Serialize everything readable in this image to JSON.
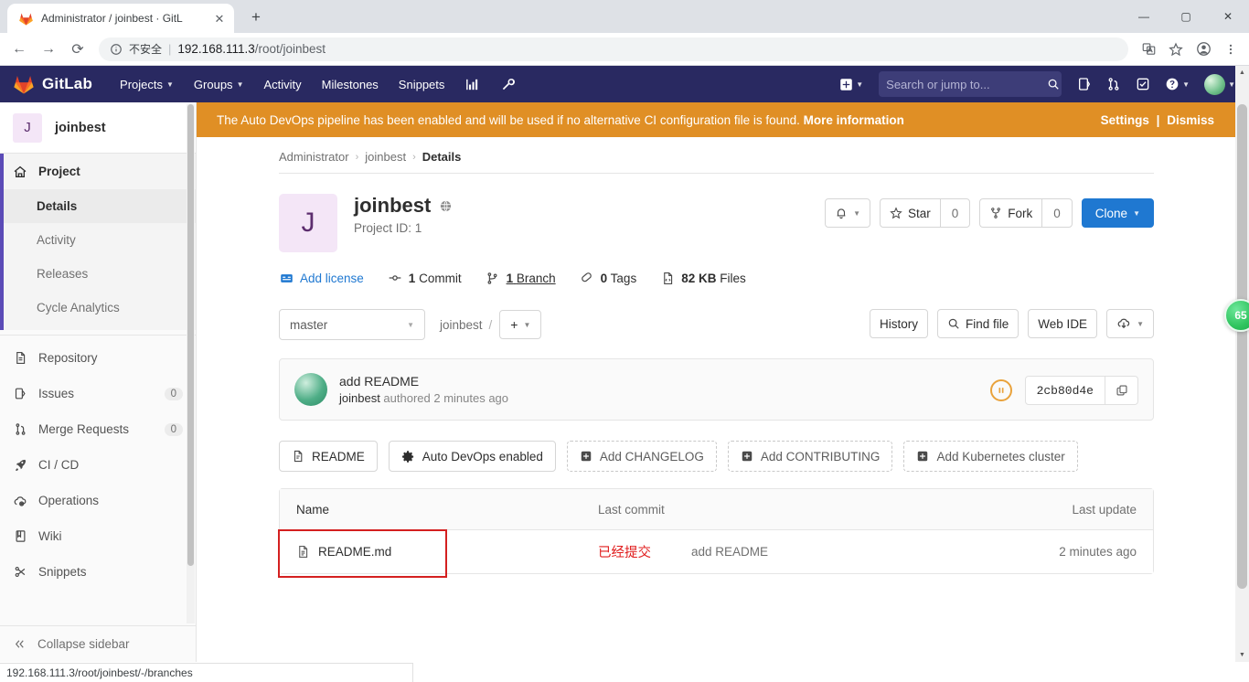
{
  "browser": {
    "tab": {
      "title": "Administrator / joinbest · GitL",
      "favicon_icon": "gitlab-tanuki-icon",
      "close_icon": "close-icon"
    },
    "new_tab_label": "+",
    "window_controls": {
      "minimize": "—",
      "maximize": "▢",
      "close": "✕"
    },
    "nav": {
      "back": "←",
      "forward": "→",
      "reload": "⟳"
    },
    "omnibox": {
      "info_icon": "info-circle-icon",
      "security_label": "不安全",
      "separator": "|",
      "url_host": "192.168.111.3",
      "url_path": "/root/joinbest"
    },
    "toolbar_icons": [
      "translate-icon",
      "bookmark-star-icon",
      "profile-icon",
      "more-menu-icon"
    ],
    "status_link": "192.168.111.3/root/joinbest/-/branches"
  },
  "navbar": {
    "brand": "GitLab",
    "links": [
      {
        "label": "Projects",
        "has_caret": true
      },
      {
        "label": "Groups",
        "has_caret": true
      },
      {
        "label": "Activity",
        "has_caret": false
      },
      {
        "label": "Milestones",
        "has_caret": false
      },
      {
        "label": "Snippets",
        "has_caret": false
      }
    ],
    "icon_links": [
      "analytics-chart-icon",
      "wrench-admin-icon"
    ],
    "plus_label": "+",
    "search_placeholder": "Search or jump to...",
    "right_icons": [
      "issues-icon",
      "merge-requests-icon",
      "todos-icon",
      "help-icon"
    ],
    "avatar_caret": "⌄"
  },
  "alert": {
    "message_plain": "The Auto DevOps pipeline has been enabled and will be used if no alternative CI configuration file is found. ",
    "message_link": "More information",
    "settings": "Settings",
    "divider": "|",
    "dismiss": "Dismiss",
    "background": "#e08f25"
  },
  "sidebar": {
    "project_initial": "J",
    "project_name": "joinbest",
    "groups": [
      {
        "label": "Project",
        "icon": "home-icon",
        "active": true,
        "children": [
          {
            "label": "Details",
            "selected": true
          },
          {
            "label": "Activity",
            "selected": false
          },
          {
            "label": "Releases",
            "selected": false
          },
          {
            "label": "Cycle Analytics",
            "selected": false
          }
        ]
      }
    ],
    "items": [
      {
        "label": "Repository",
        "icon": "document-icon",
        "count": null
      },
      {
        "label": "Issues",
        "icon": "issues-icon",
        "count": "0"
      },
      {
        "label": "Merge Requests",
        "icon": "merge-requests-icon",
        "count": "0"
      },
      {
        "label": "CI / CD",
        "icon": "rocket-icon",
        "count": null
      },
      {
        "label": "Operations",
        "icon": "cloud-gear-icon",
        "count": null
      },
      {
        "label": "Wiki",
        "icon": "book-icon",
        "count": null
      },
      {
        "label": "Snippets",
        "icon": "scissors-icon",
        "count": null
      }
    ],
    "collapse_label": "Collapse sidebar",
    "collapse_icon": "chevrons-left-icon"
  },
  "breadcrumb": {
    "items": [
      "Administrator",
      "joinbest",
      "Details"
    ],
    "separator": "›"
  },
  "project": {
    "avatar_initial": "J",
    "name": "joinbest",
    "visibility_icon": "globe-public-icon",
    "project_id_label": "Project ID: 1",
    "notification_icon": "bell-icon",
    "star_label": "Star",
    "star_count": "0",
    "fork_label": "Fork",
    "fork_count": "0",
    "clone_label": "Clone",
    "clone_accent": "#1f78d1"
  },
  "stats": [
    {
      "icon": "scale-balance-icon",
      "text": "Add license",
      "link": true,
      "bold": ""
    },
    {
      "icon": "commit-icon",
      "bold": "1",
      "text": "Commit"
    },
    {
      "icon": "branch-icon",
      "bold": "1",
      "text": "Branch",
      "underline": true
    },
    {
      "icon": "tag-icon",
      "bold": "0",
      "text": "Tags"
    },
    {
      "icon": "files-icon",
      "bold": "82 KB",
      "text": "Files"
    }
  ],
  "repo_toolbar": {
    "branch": "master",
    "path_root": "joinbest",
    "path_slash": "/",
    "add_label": "+",
    "history_label": "History",
    "find_file_label": "Find file",
    "find_file_icon": "search-icon",
    "web_ide_label": "Web IDE",
    "download_icon": "download-cloud-icon"
  },
  "commit": {
    "title": "add README",
    "author": "joinbest",
    "meta": " authored 2 minutes ago",
    "pipeline_status_icon": "pipeline-pending-icon",
    "sha": "2cb80d4e",
    "copy_icon": "copy-icon"
  },
  "quick_links": [
    {
      "label": "README",
      "icon": "document-icon",
      "dashed": false
    },
    {
      "label": "Auto DevOps enabled",
      "icon": "gear-icon",
      "dashed": false
    },
    {
      "label": "Add CHANGELOG",
      "icon": "plus-square-icon",
      "dashed": true
    },
    {
      "label": "Add CONTRIBUTING",
      "icon": "plus-square-icon",
      "dashed": true
    },
    {
      "label": "Add Kubernetes cluster",
      "icon": "plus-square-icon",
      "dashed": true
    }
  ],
  "file_table": {
    "headers": {
      "name": "Name",
      "last_commit": "Last commit",
      "last_update": "Last update"
    },
    "rows": [
      {
        "name": "README.md",
        "icon": "file-text-icon",
        "annotation": "已经提交",
        "annotation_color": "#e01b1b",
        "last_commit": "add README",
        "last_update": "2 minutes ago"
      }
    ]
  },
  "floating_badge": {
    "text": "65"
  }
}
